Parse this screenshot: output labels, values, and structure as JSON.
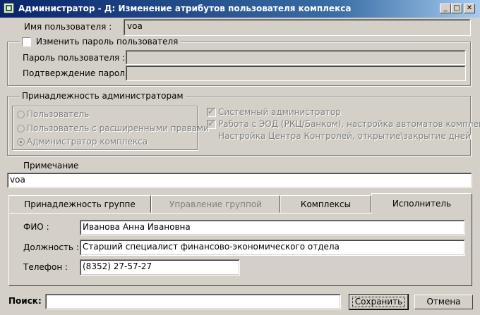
{
  "window": {
    "title": "Администратор - Д: Изменение атрибутов пользователя комплекса",
    "minimize_glyph": "_",
    "maximize_glyph": "□",
    "close_glyph": "✕"
  },
  "user": {
    "name_label": "Имя пользователя :",
    "name_value": "voa"
  },
  "password_group": {
    "legend": "Изменить пароль пользователя",
    "checked": false,
    "password_label": "Пароль пользователя :",
    "confirm_label": "Подтверждение пароля :",
    "password_value": "",
    "confirm_value": ""
  },
  "admin_group": {
    "legend": "Принадлежность администраторам",
    "radios": [
      {
        "label": "Пользователь",
        "selected": false
      },
      {
        "label": "Пользователь с расширенными правами",
        "selected": false
      },
      {
        "label": "Администратор комплекса",
        "selected": true
      }
    ],
    "checkboxes": [
      {
        "label": "Системный администратор",
        "checked": true
      },
      {
        "label": "Работа с ЭОД (РКЦ/Банком), настройка автоматов комплекса",
        "checked": true
      }
    ],
    "extra_text": "Настройка Центра Контролей, открытие\\закрытие дней"
  },
  "note": {
    "label": "Примечание",
    "value": "voa"
  },
  "tabs": [
    {
      "label": "Принадлежность группе",
      "enabled": true,
      "active": false
    },
    {
      "label": "Управление группой",
      "enabled": false,
      "active": false
    },
    {
      "label": "Комплексы",
      "enabled": true,
      "active": false
    },
    {
      "label": "Исполнитель",
      "enabled": true,
      "active": true
    }
  ],
  "executor": {
    "fio_label": "ФИО :",
    "fio_value": "Иванова Анна Ивановна",
    "position_label": "Должность :",
    "position_value": "Старший специалист финансово-экономического отдела",
    "phone_label": "Телефон :",
    "phone_value": "(8352) 27-57-27"
  },
  "footer": {
    "search_label": "Поиск:",
    "search_value": "",
    "save_label": "Сохранить",
    "cancel_label": "Отмена"
  }
}
